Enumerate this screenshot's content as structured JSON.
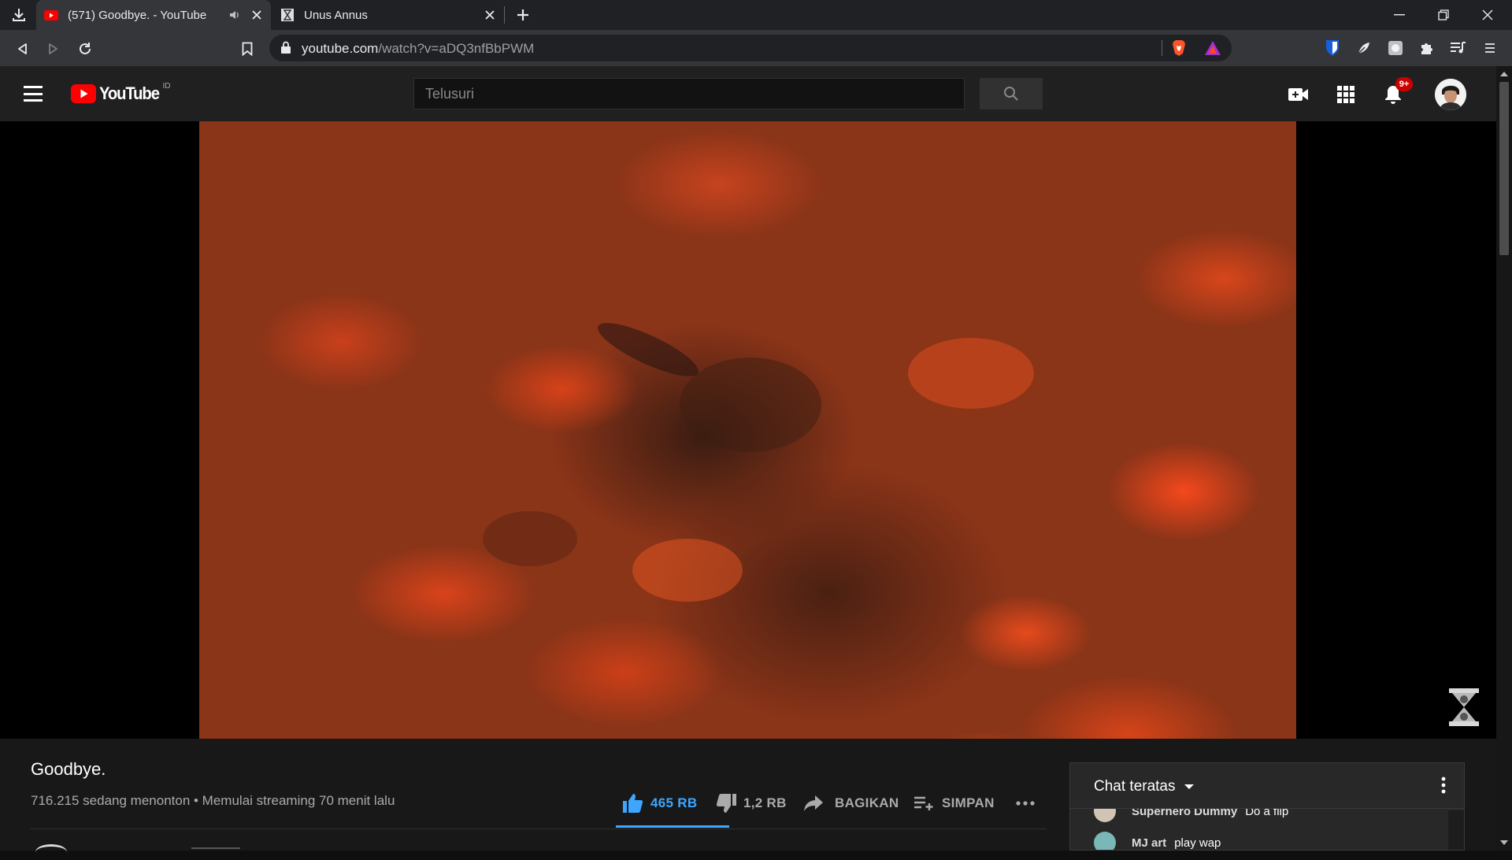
{
  "browser": {
    "tabs": [
      {
        "title": "(571) Goodbye. - YouTube",
        "favicon": "youtube-favicon",
        "active": true,
        "audio": true
      },
      {
        "title": "Unus Annus",
        "favicon": "unus-annus-favicon",
        "active": false
      }
    ],
    "url_host": "youtube.com",
    "url_path": "/watch?v=aDQ3nfBbPWM"
  },
  "youtube": {
    "logo_text": "YouTube",
    "region_code": "ID",
    "search_placeholder": "Telusuri",
    "notification_count": "9+"
  },
  "video": {
    "title": "Goodbye.",
    "meta": "716.215 sedang menonton • Memulai streaming 70 menit lalu",
    "likes": "465 RB",
    "dislikes": "1,2 RB",
    "share_label": "BAGIKAN",
    "save_label": "SIMPAN",
    "like_ratio": 0.28
  },
  "chat": {
    "title": "Chat teratas",
    "messages": [
      {
        "author": "Superhero Dummy",
        "text": "Do a flip"
      },
      {
        "author": "MJ art",
        "text": "play wap"
      }
    ]
  },
  "colors": {
    "accent_blue": "#3ea6ff",
    "youtube_red": "#ff0000",
    "badge_red": "#cc0000"
  }
}
